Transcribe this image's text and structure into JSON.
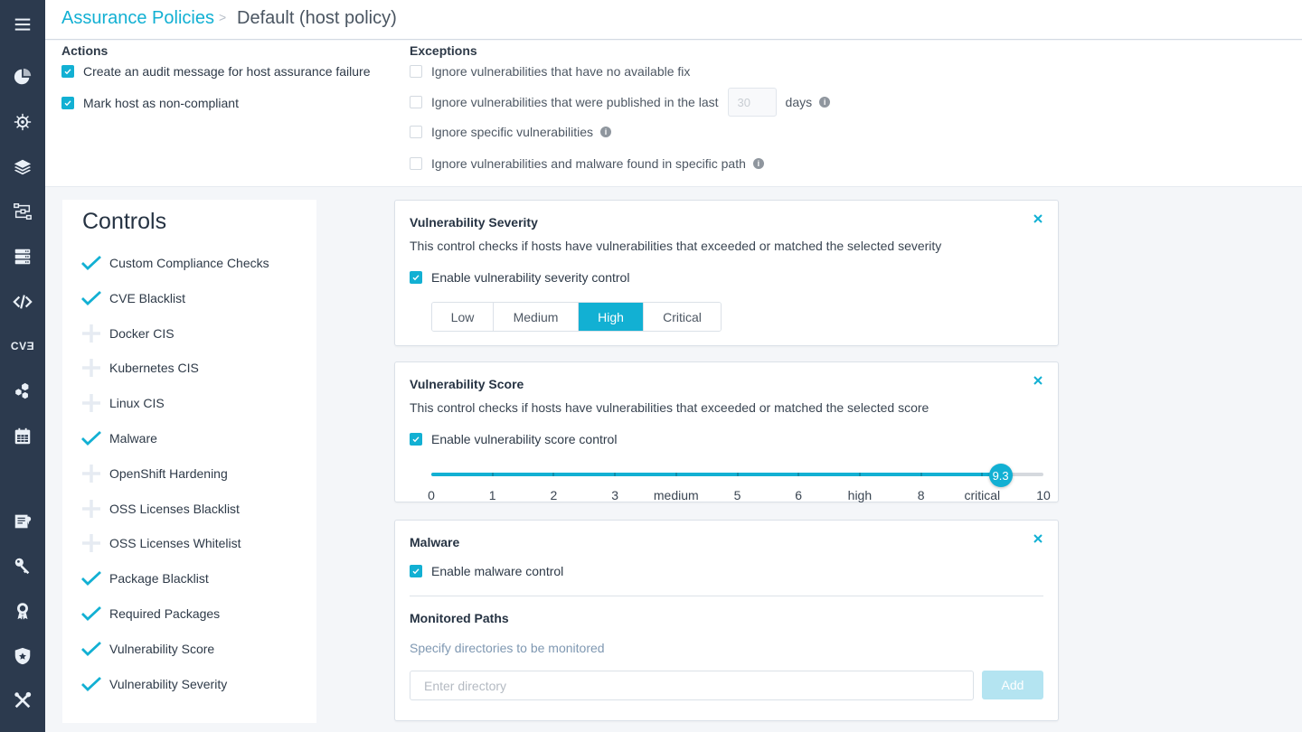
{
  "sidebar": {
    "icons": [
      {
        "name": "menu-icon"
      },
      {
        "name": "dashboard-pie-icon"
      },
      {
        "name": "kubernetes-helm-icon"
      },
      {
        "name": "layers-icon"
      },
      {
        "name": "workflow-icon"
      },
      {
        "name": "servers-icon"
      },
      {
        "name": "code-icon"
      },
      {
        "name": "cve-icon",
        "text": "CVƎ"
      },
      {
        "name": "hexagons-icon"
      },
      {
        "name": "calendar-icon"
      },
      {
        "name": "policy-document-icon"
      },
      {
        "name": "key-icon"
      },
      {
        "name": "badge-icon"
      },
      {
        "name": "shield-star-icon"
      },
      {
        "name": "tools-icon"
      }
    ]
  },
  "header": {
    "breadcrumb_root": "Assurance Policies",
    "breadcrumb_separator": ">",
    "breadcrumb_current": "Default (host policy)"
  },
  "actions": {
    "title": "Actions",
    "items": [
      {
        "label": "Create an audit message for host assurance failure",
        "checked": true
      },
      {
        "label": "Mark host as non-compliant",
        "checked": true
      }
    ]
  },
  "exceptions": {
    "title": "Exceptions",
    "items": [
      {
        "label": "Ignore vulnerabilities that have no available fix",
        "checked": false
      },
      {
        "label": "Ignore vulnerabilities that were published in the last",
        "checked": false,
        "days_value": "30",
        "suffix": "days",
        "info": true
      },
      {
        "label": "Ignore specific vulnerabilities",
        "checked": false,
        "info": true
      },
      {
        "label": "Ignore vulnerabilities and malware found in specific path",
        "checked": false,
        "info": true
      }
    ]
  },
  "controls": {
    "title": "Controls",
    "items": [
      {
        "label": "Custom Compliance Checks",
        "enabled": true
      },
      {
        "label": "CVE Blacklist",
        "enabled": true
      },
      {
        "label": "Docker CIS",
        "enabled": false
      },
      {
        "label": "Kubernetes CIS",
        "enabled": false
      },
      {
        "label": "Linux CIS",
        "enabled": false
      },
      {
        "label": "Malware",
        "enabled": true
      },
      {
        "label": "OpenShift Hardening",
        "enabled": false
      },
      {
        "label": "OSS Licenses Blacklist",
        "enabled": false
      },
      {
        "label": "OSS Licenses Whitelist",
        "enabled": false
      },
      {
        "label": "Package Blacklist",
        "enabled": true
      },
      {
        "label": "Required Packages",
        "enabled": true
      },
      {
        "label": "Vulnerability Score",
        "enabled": true
      },
      {
        "label": "Vulnerability Severity",
        "enabled": true
      }
    ]
  },
  "severity_card": {
    "title": "Vulnerability Severity",
    "description": "This control checks if hosts have vulnerabilities that exceeded or matched the selected severity",
    "enable_label": "Enable vulnerability severity control",
    "enabled": true,
    "options": [
      "Low",
      "Medium",
      "High",
      "Critical"
    ],
    "selected": "High"
  },
  "score_card": {
    "title": "Vulnerability Score",
    "description": "This control checks if hosts have vulnerabilities that exceeded or matched the selected score",
    "enable_label": "Enable vulnerability score control",
    "enabled": true,
    "min": 0,
    "max": 10,
    "value": 9.3,
    "value_label": "9.3",
    "tick_labels": [
      "0",
      "1",
      "2",
      "3",
      "medium",
      "5",
      "6",
      "high",
      "8",
      "critical",
      "10"
    ]
  },
  "malware_card": {
    "title": "Malware",
    "enable_label": "Enable malware control",
    "enabled": true,
    "monitored_paths_title": "Monitored Paths",
    "hint": "Specify directories to be monitored",
    "directory_value": "",
    "directory_placeholder": "Enter directory",
    "add_label": "Add"
  },
  "colors": {
    "accent": "#12b0d3",
    "sidebar_bg": "#2c3a4e",
    "add_button_disabled": "#b4e4f1"
  }
}
